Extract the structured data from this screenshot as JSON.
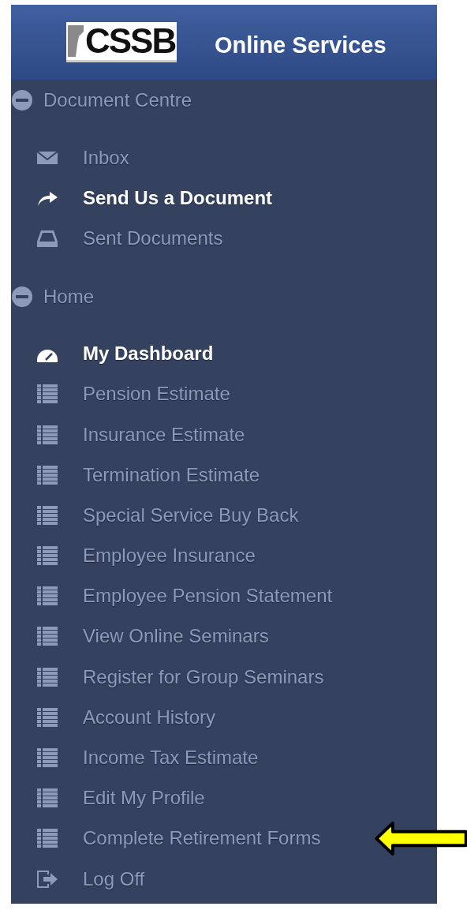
{
  "header": {
    "logo_text": "CSSB",
    "title": "Online Services"
  },
  "sections": [
    {
      "label": "Document Centre",
      "expanded": true,
      "items": [
        {
          "label": "Inbox",
          "kind": "envelope",
          "highlighted": false,
          "pointed_at": false
        },
        {
          "label": "Send Us a Document",
          "kind": "share",
          "highlighted": true,
          "pointed_at": false
        },
        {
          "label": "Sent Documents",
          "kind": "tray",
          "highlighted": false,
          "pointed_at": false
        }
      ]
    },
    {
      "label": "Home",
      "expanded": true,
      "items": [
        {
          "label": "My Dashboard",
          "kind": "gauge",
          "highlighted": true,
          "pointed_at": false
        },
        {
          "label": "Pension Estimate",
          "kind": "list",
          "highlighted": false,
          "pointed_at": false
        },
        {
          "label": "Insurance Estimate",
          "kind": "list",
          "highlighted": false,
          "pointed_at": false
        },
        {
          "label": "Termination Estimate",
          "kind": "list",
          "highlighted": false,
          "pointed_at": false
        },
        {
          "label": "Special Service Buy Back",
          "kind": "list",
          "highlighted": false,
          "pointed_at": false
        },
        {
          "label": "Employee Insurance",
          "kind": "list",
          "highlighted": false,
          "pointed_at": false
        },
        {
          "label": "Employee Pension Statement",
          "kind": "list",
          "highlighted": false,
          "pointed_at": false
        },
        {
          "label": "View Online Seminars",
          "kind": "list",
          "highlighted": false,
          "pointed_at": false
        },
        {
          "label": "Register for Group Seminars",
          "kind": "list",
          "highlighted": false,
          "pointed_at": false
        },
        {
          "label": "Account History",
          "kind": "list",
          "highlighted": false,
          "pointed_at": false
        },
        {
          "label": "Income Tax Estimate",
          "kind": "list",
          "highlighted": false,
          "pointed_at": false
        },
        {
          "label": "Edit My Profile",
          "kind": "list",
          "highlighted": false,
          "pointed_at": false
        },
        {
          "label": "Complete Retirement Forms",
          "kind": "list",
          "highlighted": false,
          "pointed_at": true
        },
        {
          "label": "Log Off",
          "kind": "logout",
          "highlighted": false,
          "pointed_at": false
        }
      ]
    }
  ]
}
